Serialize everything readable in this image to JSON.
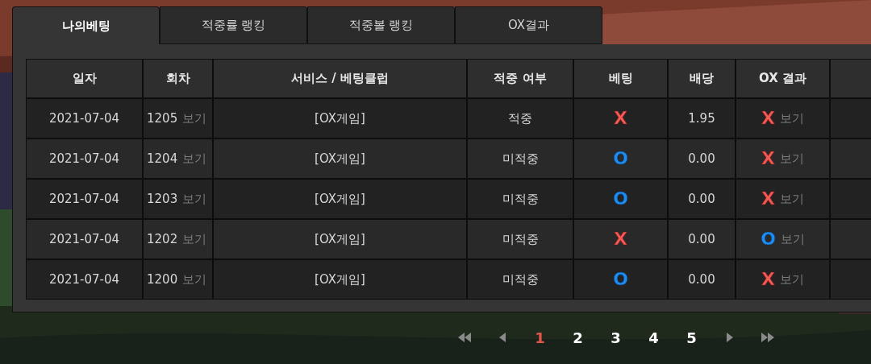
{
  "tabs": [
    {
      "label": "나의베팅",
      "selected": true
    },
    {
      "label": "적중률 랭킹",
      "selected": false
    },
    {
      "label": "적중볼 랭킹",
      "selected": false
    },
    {
      "label": "OX결과",
      "selected": false
    }
  ],
  "table": {
    "columns": [
      "일자",
      "회차",
      "서비스 / 베팅클럽",
      "적중 여부",
      "베팅",
      "배당",
      "OX 결과"
    ],
    "rows": [
      {
        "date": "2021-07-04",
        "round": "1205",
        "view": "보기",
        "service": "[OX게임]",
        "hit": "적중",
        "bet": {
          "kind": "cross",
          "label": "X"
        },
        "odds": "1.95",
        "result": {
          "kind": "cross",
          "label": "X"
        },
        "result_view": "보기"
      },
      {
        "date": "2021-07-04",
        "round": "1204",
        "view": "보기",
        "service": "[OX게임]",
        "hit": "미적중",
        "bet": {
          "kind": "circle",
          "label": "O"
        },
        "odds": "0.00",
        "result": {
          "kind": "cross",
          "label": "X"
        },
        "result_view": "보기"
      },
      {
        "date": "2021-07-04",
        "round": "1203",
        "view": "보기",
        "service": "[OX게임]",
        "hit": "미적중",
        "bet": {
          "kind": "circle",
          "label": "O"
        },
        "odds": "0.00",
        "result": {
          "kind": "cross",
          "label": "X"
        },
        "result_view": "보기"
      },
      {
        "date": "2021-07-04",
        "round": "1202",
        "view": "보기",
        "service": "[OX게임]",
        "hit": "미적중",
        "bet": {
          "kind": "cross",
          "label": "X"
        },
        "odds": "0.00",
        "result": {
          "kind": "circle",
          "label": "O"
        },
        "result_view": "보기"
      },
      {
        "date": "2021-07-04",
        "round": "1200",
        "view": "보기",
        "service": "[OX게임]",
        "hit": "미적중",
        "bet": {
          "kind": "circle",
          "label": "O"
        },
        "odds": "0.00",
        "result": {
          "kind": "cross",
          "label": "X"
        },
        "result_view": "보기"
      }
    ]
  },
  "pagination": {
    "pages": [
      {
        "label": "1",
        "selected": true
      },
      {
        "label": "2",
        "selected": false
      },
      {
        "label": "3",
        "selected": false
      },
      {
        "label": "4",
        "selected": false
      },
      {
        "label": "5",
        "selected": false
      }
    ]
  }
}
